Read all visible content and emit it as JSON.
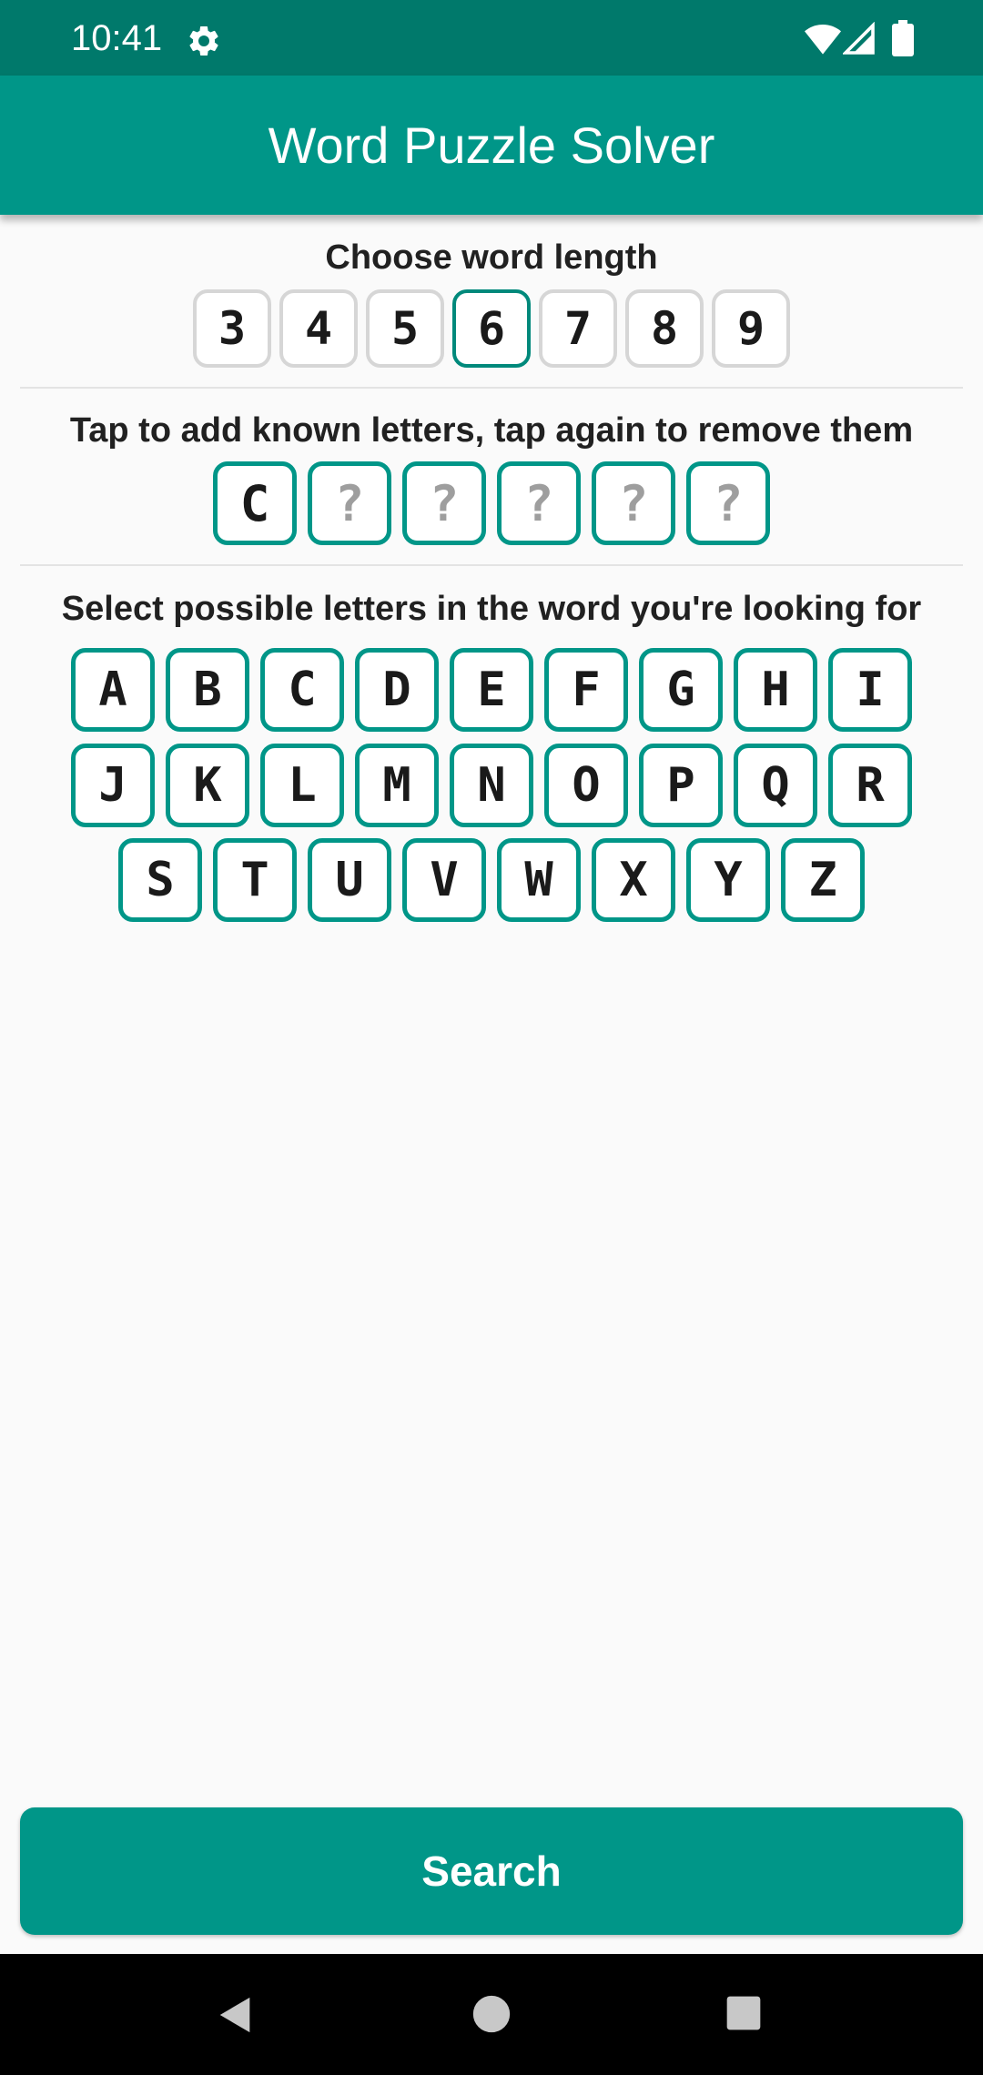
{
  "status_bar": {
    "time": "10:41",
    "icons": [
      "gear-icon",
      "wifi-icon",
      "signal-icon",
      "battery-icon"
    ]
  },
  "app_bar": {
    "title": "Word Puzzle Solver"
  },
  "word_length": {
    "label": "Choose word length",
    "options": [
      "3",
      "4",
      "5",
      "6",
      "7",
      "8",
      "9"
    ],
    "selected": "6"
  },
  "known_letters": {
    "label": "Tap to add known letters, tap again to remove them",
    "slots": [
      "C",
      "?",
      "?",
      "?",
      "?",
      "?"
    ]
  },
  "possible_letters": {
    "label": "Select possible letters in the word you're looking for",
    "rows": [
      [
        "A",
        "B",
        "C",
        "D",
        "E",
        "F",
        "G",
        "H",
        "I"
      ],
      [
        "J",
        "K",
        "L",
        "M",
        "N",
        "O",
        "P",
        "Q",
        "R"
      ],
      [
        "S",
        "T",
        "U",
        "V",
        "W",
        "X",
        "Y",
        "Z"
      ]
    ]
  },
  "search_button": {
    "label": "Search"
  },
  "nav_bar": {
    "icons": [
      "back-icon",
      "home-icon",
      "recents-icon"
    ]
  },
  "colors": {
    "status_bar": "#00796b",
    "primary": "#009688",
    "unselected_border": "#d6d6d6",
    "placeholder_text": "#9e9e9e"
  }
}
